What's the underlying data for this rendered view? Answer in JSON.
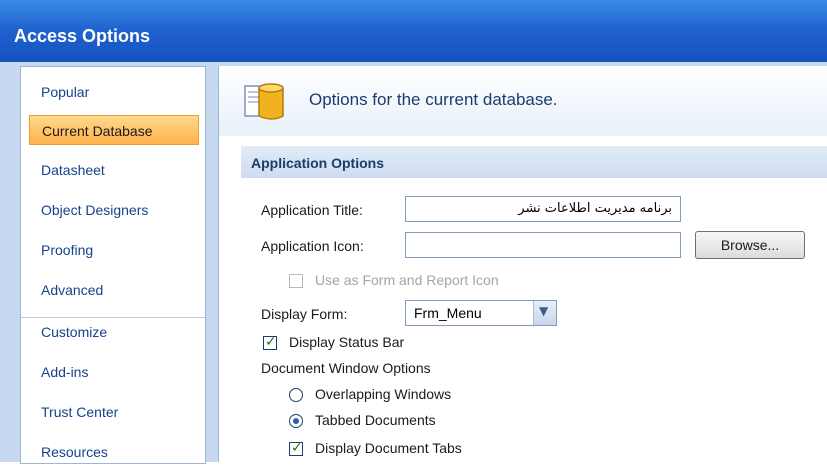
{
  "window": {
    "title": "Access Options"
  },
  "sidebar": {
    "items": [
      {
        "label": "Popular"
      },
      {
        "label": "Current Database",
        "selected": true
      },
      {
        "label": "Datasheet"
      },
      {
        "label": "Object Designers"
      },
      {
        "label": "Proofing"
      },
      {
        "label": "Advanced"
      },
      {
        "label": "Customize"
      },
      {
        "label": "Add-ins"
      },
      {
        "label": "Trust Center"
      },
      {
        "label": "Resources"
      }
    ]
  },
  "main": {
    "header_text": "Options for the current database.",
    "section_title": "Application Options",
    "app_title_label": "Application Title:",
    "app_title_value": "برنامه مدیریت اطلاعات نشر",
    "app_icon_label": "Application Icon:",
    "app_icon_value": "",
    "browse_label": "Browse...",
    "use_as_form_icon_label": "Use as Form and Report Icon",
    "display_form_label": "Display Form:",
    "display_form_value": "Frm_Menu",
    "display_status_bar_label": "Display Status Bar",
    "doc_window_options_label": "Document Window Options",
    "overlapping_label": "Overlapping Windows",
    "tabbed_label": "Tabbed Documents",
    "display_doc_tabs_label": "Display Document Tabs"
  },
  "colors": {
    "titlebar": "#1f62cf",
    "selected_item": "#ffc062",
    "accent_text": "#15428b"
  }
}
